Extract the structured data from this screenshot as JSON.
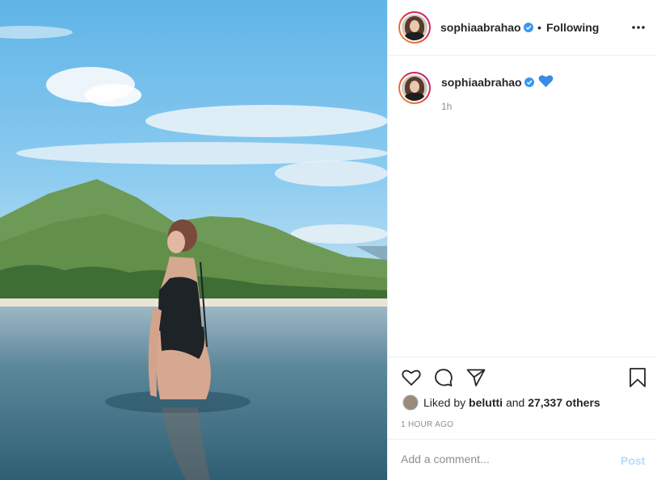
{
  "header": {
    "username": "sophiaabrahao",
    "separator": "•",
    "follow_status": "Following"
  },
  "caption": {
    "username": "sophiaabrahao",
    "emoji": "blue-heart",
    "time_ago": "1h"
  },
  "likes": {
    "prefix": "Liked by",
    "liker": "belutti",
    "joiner": "and",
    "others": "27,337 others"
  },
  "timestamp": "1 HOUR AGO",
  "comment": {
    "placeholder": "Add a comment...",
    "post_label": "Post"
  },
  "icons": [
    "more-icon",
    "verified-badge-icon",
    "heart-icon",
    "comment-icon",
    "share-icon",
    "bookmark-icon"
  ],
  "colors": {
    "verified": "#3897f0",
    "post_disabled": "#b3dbff",
    "heart_emoji": "#3b8be6",
    "muted_text": "#8e8e8e"
  }
}
